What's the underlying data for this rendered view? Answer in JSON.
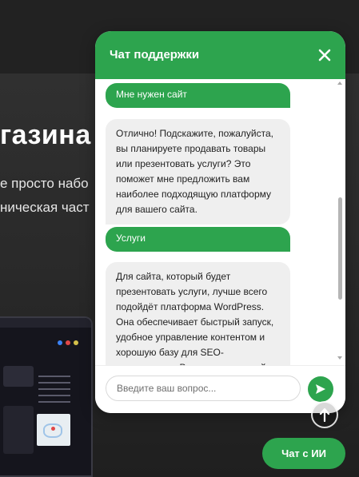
{
  "background": {
    "heading": "газина",
    "line1": "е просто набо",
    "line2": "ническая част"
  },
  "chat": {
    "title": "Чат поддержки",
    "close_icon": "close-icon",
    "messages": [
      {
        "role": "user",
        "text": "Мне нужен сайт"
      },
      {
        "role": "bot",
        "text": "Отлично! Подскажите, пожалуйста, вы планируете продавать товары или презентовать услуги? Это поможет мне предложить вам наиболее подходящую платформу для вашего сайта."
      },
      {
        "role": "user",
        "text": "Услуги"
      },
      {
        "role": "bot",
        "text": "Для сайта, который будет презентовать услуги, лучше всего подойдёт платформа WordPress. Она обеспечивает быстрый запуск, удобное управление контентом и хорошую базу для SEO-оптимизации. Вам нужен простой"
      }
    ],
    "input": {
      "placeholder": "Введите ваш вопрос...",
      "value": ""
    },
    "send_icon": "send-icon"
  },
  "scroll_top_icon": "arrow-up-icon",
  "ai_chat_button": "Чат с ИИ",
  "colors": {
    "accent": "#2da44e",
    "bot_bubble": "#efefef",
    "page_bg": "#2a2a2a"
  }
}
